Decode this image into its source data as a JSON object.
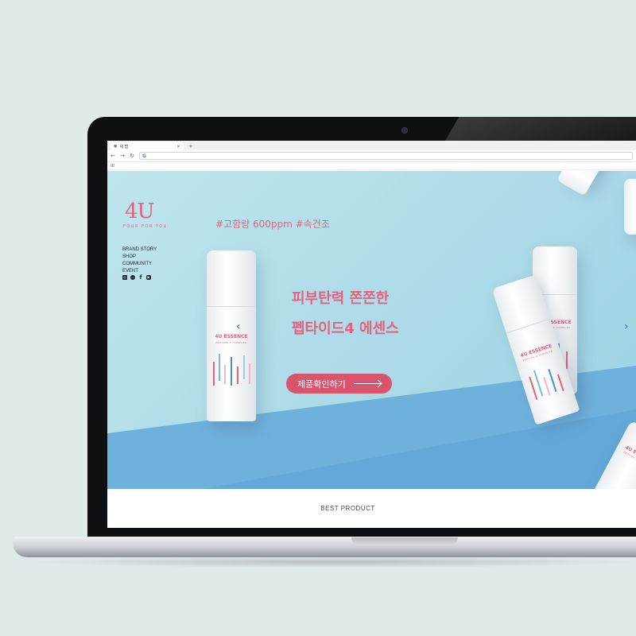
{
  "browser": {
    "tab_title": "새 탭",
    "tab_close": "×",
    "new_tab": "+",
    "address": "",
    "search_engine_glyph": "G"
  },
  "site": {
    "logo": "4U",
    "logo_sub": "FOUR FOR YOU",
    "nav": [
      "BRAND STORY",
      "SHOP",
      "COMMUNITY",
      "EVENT"
    ],
    "socials": [
      "instagram-icon",
      "kakaotalk-icon",
      "facebook-icon",
      "youtube-icon"
    ],
    "brand_color": "#e3607e",
    "cta_color": "#d9556e"
  },
  "hero": {
    "hashtags": "#고함량 600ppm #속건조",
    "headline_line1": "피부탄력 쫀쫀한",
    "headline_line2": "펩타이드4 에센스",
    "cta_label": "제품확인하기",
    "prev_arrow": "‹",
    "next_arrow": "›",
    "bottle_label": "4U ESSENCE",
    "bottle_sub": "PEPTIDE 4 COMPLEX"
  },
  "sections": {
    "best_product": "BEST PRODUCT"
  }
}
